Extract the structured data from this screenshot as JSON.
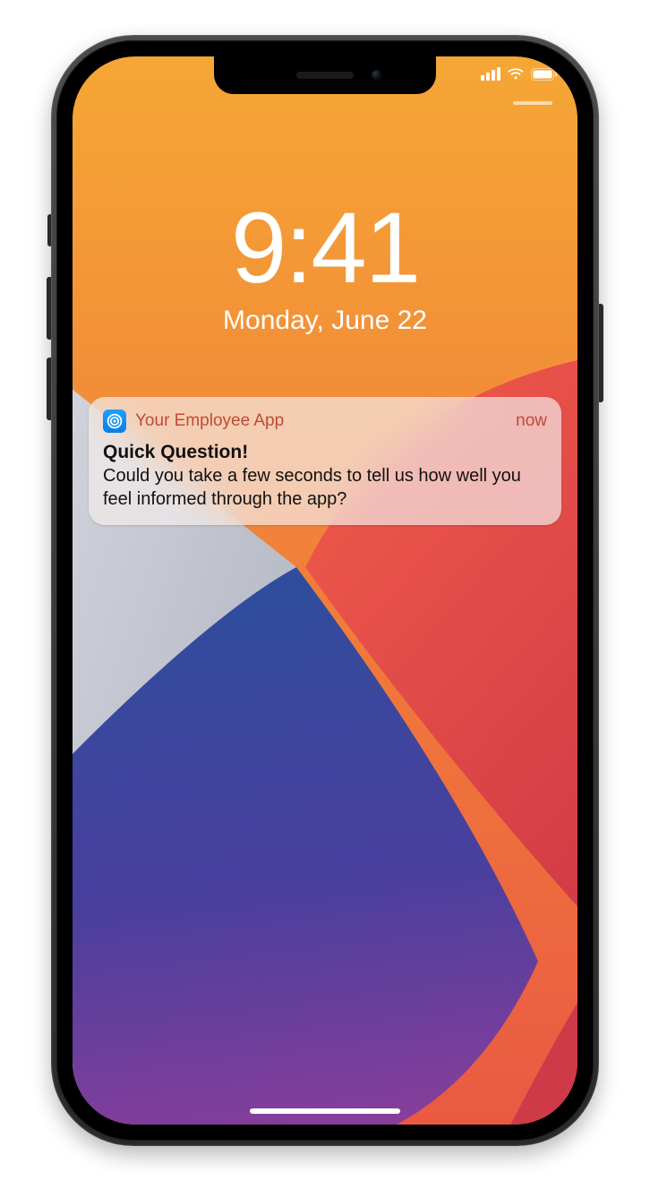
{
  "lockscreen": {
    "time": "9:41",
    "date": "Monday, June 22"
  },
  "status": {
    "signal_bars": 4,
    "wifi_bars": 3,
    "battery_pct": 100
  },
  "notification": {
    "app_name": "Your Employee App",
    "time_label": "now",
    "title": "Quick Question!",
    "body": "Could you take a few seconds to tell us how well you feel informed through the app?",
    "icon_name": "target-icon"
  },
  "colors": {
    "notif_accent": "#c24a34",
    "icon_bg": "#1596f5"
  }
}
